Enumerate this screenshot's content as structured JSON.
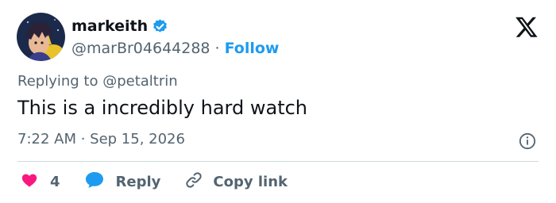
{
  "author": {
    "display_name": "markeith",
    "handle": "@marBr04644288",
    "separator": "·",
    "follow_label": "Follow",
    "verified": true,
    "avatar_icon": "avatar-image"
  },
  "platform_icon": "x-logo-icon",
  "tweet": {
    "reply_context": "Replying to @petaltrin",
    "text": "This is a incredibly hard watch",
    "timestamp": "7:22 AM · Sep 15, 2026"
  },
  "actions": {
    "like_count": "4",
    "reply_label": "Reply",
    "copy_link_label": "Copy link"
  },
  "colors": {
    "text_primary": "#0f1419",
    "text_secondary": "#536471",
    "accent_blue": "#1d9bf0",
    "like_red": "#f91880",
    "divider": "#cfd9de"
  }
}
